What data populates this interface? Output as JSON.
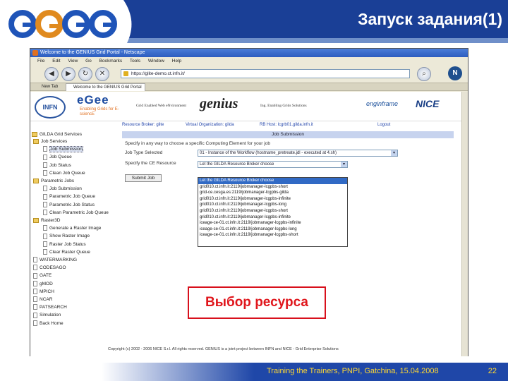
{
  "slide": {
    "title": "Запуск задания(1)",
    "footer_text": "Training the Trainers, PNPI, Gatchina, 15.04.2008",
    "page_number": "22",
    "callout": "Выбор ресурса",
    "logo_text": "egee"
  },
  "browser": {
    "window_title": "Welcome to the GENIUS Grid Portal - Netscape",
    "menu": [
      "File",
      "Edit",
      "View",
      "Go",
      "Bookmarks",
      "Tools",
      "Window",
      "Help"
    ],
    "url": "https://glite-demo.ct.infn.it/",
    "tabs": [
      "New Tab",
      "Welcome to the GENIUS Grid Portal"
    ],
    "netscape_btn": "N"
  },
  "portal": {
    "logos": {
      "infn": "INFN",
      "egee": "eGee",
      "egee_sub": "Enabling Grids for E-sciencE",
      "consortium_a": "Grid Enabled Web eNvironment",
      "genius": "genius",
      "consortium_b": "Ing. Enabling Grids Solutions",
      "enginframe": "enginframe",
      "nice": "NICE"
    },
    "topnav": [
      "Resource Broker: glite",
      "Virtual Organization: gilda",
      "RB Host: lcgrb01.gilda.infn.it",
      "Logout"
    ],
    "sidebar_header": "GILDA Grid Services",
    "tree": [
      {
        "label": "Job Services",
        "type": "folder",
        "indent": 0
      },
      {
        "label": "Job Submission",
        "type": "doc",
        "indent": 1,
        "selected": true
      },
      {
        "label": "Job Queue",
        "type": "doc",
        "indent": 1
      },
      {
        "label": "Job Status",
        "type": "doc",
        "indent": 1
      },
      {
        "label": "Clean Job Queue",
        "type": "doc",
        "indent": 1
      },
      {
        "label": "Parametric Jobs",
        "type": "folder",
        "indent": 0
      },
      {
        "label": "Job Submission",
        "type": "doc",
        "indent": 1
      },
      {
        "label": "Parametric Job Queue",
        "type": "doc",
        "indent": 1
      },
      {
        "label": "Parametric Job Status",
        "type": "doc",
        "indent": 1
      },
      {
        "label": "Clean Parametric Job Queue",
        "type": "doc",
        "indent": 1
      },
      {
        "label": "Raster3D",
        "type": "folder",
        "indent": 0
      },
      {
        "label": "Generate a Raster Image",
        "type": "doc",
        "indent": 1
      },
      {
        "label": "Show Raster Image",
        "type": "doc",
        "indent": 1
      },
      {
        "label": "Raster Job Status",
        "type": "doc",
        "indent": 1
      },
      {
        "label": "Clear Raster Queue",
        "type": "doc",
        "indent": 1
      },
      {
        "label": "WATERMARKING",
        "type": "doc",
        "indent": 0
      },
      {
        "label": "CODESAGO",
        "type": "doc",
        "indent": 0
      },
      {
        "label": "GATE",
        "type": "doc",
        "indent": 0
      },
      {
        "label": "gMOD",
        "type": "doc",
        "indent": 0
      },
      {
        "label": "MPICH",
        "type": "doc",
        "indent": 0
      },
      {
        "label": "NCAR",
        "type": "doc",
        "indent": 0
      },
      {
        "label": "PATSEARCH",
        "type": "doc",
        "indent": 0
      },
      {
        "label": "Simulation",
        "type": "doc",
        "indent": 0
      },
      {
        "label": "Back Home",
        "type": "doc",
        "indent": 0
      }
    ],
    "job_submission": {
      "header": "Job Submission",
      "intro": "Specify in any way to choose a specific Computing Element for your job",
      "type_label": "Job Type Selected",
      "type_value": "01 - Instance of the Workflow (hostname_pretreate.jdl - executed at 4.sh)",
      "resource_label": "Specify the CE Resource",
      "resource_value": "Let the GILDA Resource Broker choose",
      "submit_label": "Submit Job",
      "options": [
        "Let the GILDA Resource Broker choose",
        "grid010.ct.infn.it:2119/jobmanager-lcgpbs-short",
        "grid-ce.cesga.es:2119/jobmanager-lcgpbs-gilda",
        "grid010.ct.infn.it:2119/jobmanager-lcgpbs-infinite",
        "grid010.ct.infn.it:2119/jobmanager-lcgpbs-long",
        "grid010.ct.infn.it:2119/jobmanager-lcgpbs-short",
        "grid010.ct.infn.it:2119/jobmanager-lcgpbs-infinite",
        "iceage-ce-01.ct.infn.it:2119/jobmanager-lcgpbs-infinite",
        "iceage-ce-01.ct.infn.it:2119/jobmanager-lcgpbs-long",
        "iceage-ce-01.ct.infn.it:2119/jobmanager-lcgpbs-short"
      ]
    },
    "copyright": "Copyright (c) 2002 - 2006 NICE S.r.l. All rights reserved. GENIUS is a joint project between INFN and NICE - Grid Enterprise Solutions"
  }
}
